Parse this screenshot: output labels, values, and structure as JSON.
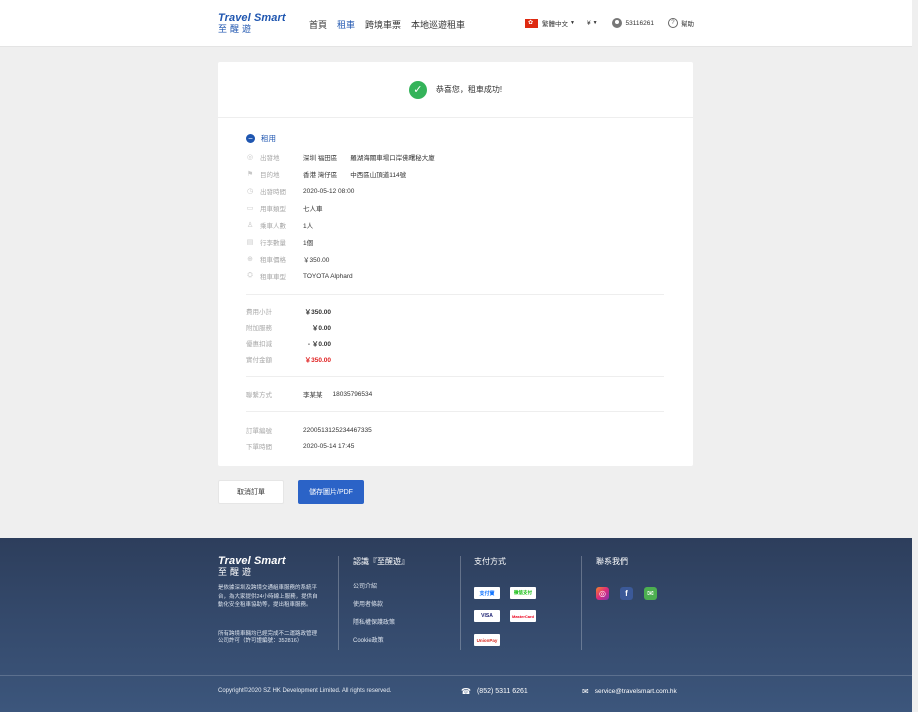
{
  "brand": {
    "en": "Travel Smart",
    "cn": "至醒遊"
  },
  "nav": [
    {
      "label": "首頁",
      "active": false
    },
    {
      "label": "租車",
      "active": true
    },
    {
      "label": "跨境車票",
      "active": false
    },
    {
      "label": "本地巡遊租車",
      "active": false
    }
  ],
  "header": {
    "language": "繁體中文",
    "currency": "¥",
    "user": "53116261",
    "help": "幫助"
  },
  "success": {
    "message": "恭喜您，租車成功!"
  },
  "section": {
    "title": "租用"
  },
  "details": [
    {
      "icon": "pin-icon",
      "label": "出發地",
      "value": "深圳 福田區　　羅湖海關車場口岸佛曙秘大廈"
    },
    {
      "icon": "flag-icon",
      "label": "目的地",
      "value": "香港 灣仔區　　中西區山頂道114號"
    },
    {
      "icon": "clock-icon",
      "label": "出發時間",
      "value": "2020-05-12  08:00"
    },
    {
      "icon": "car-icon",
      "label": "用車類型",
      "value": "七人車"
    },
    {
      "icon": "person-icon",
      "label": "乘車人數",
      "value": "1人"
    },
    {
      "icon": "luggage-icon",
      "label": "行李數量",
      "value": "1個"
    },
    {
      "icon": "price-icon",
      "label": "租車價格",
      "value": "￥350.00"
    },
    {
      "icon": "vehicle-icon",
      "label": "租車車型",
      "value": "TOYOTA Alphard"
    }
  ],
  "fees": [
    {
      "label": "費用小計",
      "value": "￥350.00",
      "highlight": false
    },
    {
      "label": "附加服務",
      "value": "￥0.00",
      "highlight": false
    },
    {
      "label": "優惠扣減",
      "value": "- ￥0.00",
      "highlight": false
    },
    {
      "label": "實付金額",
      "value": "￥350.00",
      "highlight": true
    }
  ],
  "contact": {
    "label": "聯繫方式",
    "name": "李某某",
    "phone": "18035796534"
  },
  "order": [
    {
      "label": "訂單編號",
      "value": "2200513125234467335"
    },
    {
      "label": "下單時間",
      "value": "2020-05-14  17:45"
    }
  ],
  "buttons": {
    "cancel": "取消訂單",
    "save": "儲存圖片/PDF"
  },
  "footer": {
    "desc1": "是依據深圳及跨境交通組車服務的系統平台，為大家提供24小時線上服務，提供自動化安全租車協助等，提出租車服務。",
    "desc2": "所有跨境車輛均已經完成不二運路政管理公司許可（許可證編號：352816）",
    "about": {
      "title": "認識『至醒遊』",
      "links": [
        "公司介紹",
        "使用者條款",
        "隱私權保護政策",
        "Cookie政策"
      ]
    },
    "payment": {
      "title": "支付方式",
      "methods": [
        "支付寶",
        "微信支付",
        "VISA",
        "MasterCard",
        "UnionPay"
      ]
    },
    "contact": {
      "title": "聯系我們"
    },
    "copyright": "Copyright©2020 SZ HK Development Limited. All rights reserved.",
    "phone": "(852) 5311 6261",
    "email": "service@travelsmart.com.hk"
  },
  "colors": {
    "brand": "#1f56b0",
    "button": "#2b63c7",
    "success": "#34b35a",
    "price": "#e02020",
    "footer": "#34496b"
  }
}
